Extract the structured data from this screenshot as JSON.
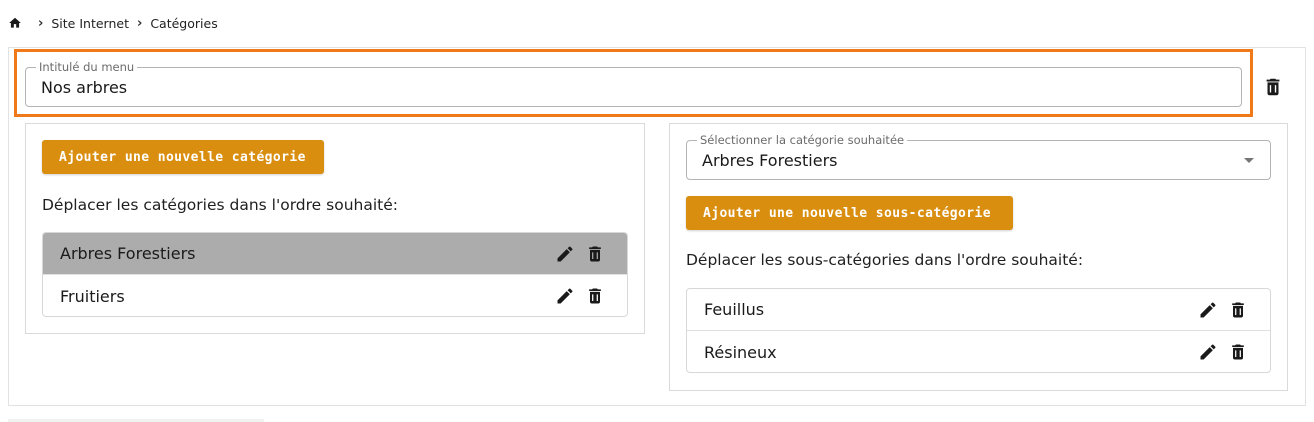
{
  "breadcrumb": {
    "icon": "home-icon",
    "items": [
      "Site Internet",
      "Catégories"
    ]
  },
  "menu": {
    "label": "Intitulé du menu",
    "value": "Nos arbres"
  },
  "categories": {
    "add_button": "Ajouter une nouvelle catégorie",
    "helper": "Déplacer les catégories dans l'ordre souhaité:",
    "items": [
      {
        "label": "Arbres Forestiers",
        "selected": true
      },
      {
        "label": "Fruitiers",
        "selected": false
      }
    ]
  },
  "subcategories": {
    "select_label": "Sélectionner la catégorie souhaitée",
    "select_value": "Arbres Forestiers",
    "add_button": "Ajouter une nouvelle sous-catégorie",
    "helper": "Déplacer les sous-catégories dans l'ordre souhaité:",
    "items": [
      {
        "label": "Feuillus"
      },
      {
        "label": "Résineux"
      }
    ]
  },
  "colors": {
    "accent": "#d98e0f",
    "highlight": "#f07a1a",
    "selected_row": "#acacac"
  }
}
